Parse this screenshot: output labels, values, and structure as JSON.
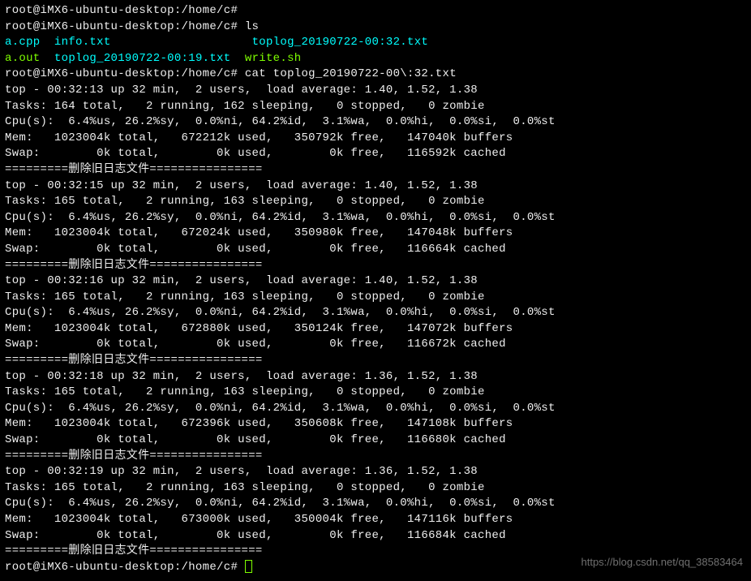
{
  "prompt": "root@iMX6-ubuntu-desktop:/home/c#",
  "prompt_space": "root@iMX6-ubuntu-desktop:/home/c# ",
  "cmds": {
    "ls": "ls",
    "cat": "cat toplog_20190722-00\\:32.txt"
  },
  "ls_output": {
    "row1": {
      "col1": "a.cpp",
      "col2": "info.txt",
      "col3": "toplog_20190722-00:32.txt"
    },
    "row2": {
      "aout": "a.out",
      "file2": "toplog_20190722-00:19.txt",
      "writesh": "write.sh"
    }
  },
  "separator": "=========删除旧日志文件================",
  "snapshots": [
    {
      "top": "top - 00:32:13 up 32 min,  2 users,  load average: 1.40, 1.52, 1.38",
      "tasks": "Tasks: 164 total,   2 running, 162 sleeping,   0 stopped,   0 zombie",
      "cpu": "Cpu(s):  6.4%us, 26.2%sy,  0.0%ni, 64.2%id,  3.1%wa,  0.0%hi,  0.0%si,  0.0%st",
      "mem": "Mem:   1023004k total,   672212k used,   350792k free,   147040k buffers",
      "swap": "Swap:        0k total,        0k used,        0k free,   116592k cached"
    },
    {
      "top": "top - 00:32:15 up 32 min,  2 users,  load average: 1.40, 1.52, 1.38",
      "tasks": "Tasks: 165 total,   2 running, 163 sleeping,   0 stopped,   0 zombie",
      "cpu": "Cpu(s):  6.4%us, 26.2%sy,  0.0%ni, 64.2%id,  3.1%wa,  0.0%hi,  0.0%si,  0.0%st",
      "mem": "Mem:   1023004k total,   672024k used,   350980k free,   147048k buffers",
      "swap": "Swap:        0k total,        0k used,        0k free,   116664k cached"
    },
    {
      "top": "top - 00:32:16 up 32 min,  2 users,  load average: 1.40, 1.52, 1.38",
      "tasks": "Tasks: 165 total,   2 running, 163 sleeping,   0 stopped,   0 zombie",
      "cpu": "Cpu(s):  6.4%us, 26.2%sy,  0.0%ni, 64.2%id,  3.1%wa,  0.0%hi,  0.0%si,  0.0%st",
      "mem": "Mem:   1023004k total,   672880k used,   350124k free,   147072k buffers",
      "swap": "Swap:        0k total,        0k used,        0k free,   116672k cached"
    },
    {
      "top": "top - 00:32:18 up 32 min,  2 users,  load average: 1.36, 1.52, 1.38",
      "tasks": "Tasks: 165 total,   2 running, 163 sleeping,   0 stopped,   0 zombie",
      "cpu": "Cpu(s):  6.4%us, 26.2%sy,  0.0%ni, 64.2%id,  3.1%wa,  0.0%hi,  0.0%si,  0.0%st",
      "mem": "Mem:   1023004k total,   672396k used,   350608k free,   147108k buffers",
      "swap": "Swap:        0k total,        0k used,        0k free,   116680k cached"
    },
    {
      "top": "top - 00:32:19 up 32 min,  2 users,  load average: 1.36, 1.52, 1.38",
      "tasks": "Tasks: 165 total,   2 running, 163 sleeping,   0 stopped,   0 zombie",
      "cpu": "Cpu(s):  6.4%us, 26.2%sy,  0.0%ni, 64.2%id,  3.1%wa,  0.0%hi,  0.0%si,  0.0%st",
      "mem": "Mem:   1023004k total,   673000k used,   350004k free,   147116k buffers",
      "swap": "Swap:        0k total,        0k used,        0k free,   116684k cached"
    }
  ],
  "watermark": "https://blog.csdn.net/qq_38583464"
}
